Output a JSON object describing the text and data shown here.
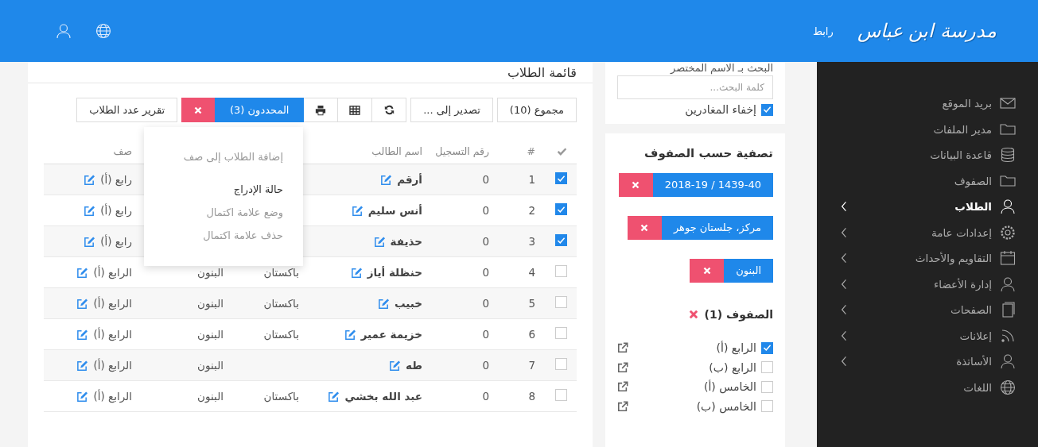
{
  "header": {
    "logo": "مدرسة ابن عباس",
    "link": "رابط"
  },
  "sidebar": {
    "items": [
      {
        "label": "بريد الموقع",
        "kind": "mail",
        "expandable": false,
        "selected": false
      },
      {
        "label": "مدير الملفات",
        "kind": "folder",
        "expandable": false,
        "selected": false
      },
      {
        "label": "قاعدة البيانات",
        "kind": "database",
        "expandable": false,
        "selected": false
      },
      {
        "label": "الصفوف",
        "kind": "folder",
        "expandable": false,
        "selected": false
      },
      {
        "label": "الطلاب",
        "kind": "user",
        "expandable": true,
        "selected": true
      },
      {
        "label": "إعدادات عامة",
        "kind": "gear",
        "expandable": true,
        "selected": false
      },
      {
        "label": "التقاويم والأحداث",
        "kind": "calendar",
        "expandable": true,
        "selected": false
      },
      {
        "label": "إدارة الأعضاء",
        "kind": "user",
        "expandable": true,
        "selected": false
      },
      {
        "label": "الصفحات",
        "kind": "pages",
        "expandable": true,
        "selected": false
      },
      {
        "label": "إعلانات",
        "kind": "rss",
        "expandable": true,
        "selected": false
      },
      {
        "label": "الأساتذة",
        "kind": "user",
        "expandable": true,
        "selected": false
      },
      {
        "label": "اللغات",
        "kind": "globe",
        "expandable": false,
        "selected": false
      }
    ]
  },
  "search": {
    "title": "البحث بـ الاسم المختصر",
    "placeholder": "كلمة البحث...",
    "hide_departed": {
      "label": "إخفاء المغادرين",
      "checked": true
    }
  },
  "filter": {
    "title": "تصفية حسب الصفوف",
    "chips": [
      "1439-40 / 2018-19",
      "مركز، جلستان جوهر",
      "البنون"
    ],
    "classes_title": "الصفوف (1)",
    "classes": [
      {
        "label": "الرابع (أ)",
        "checked": true
      },
      {
        "label": "الرابع (ب)",
        "checked": false
      },
      {
        "label": "الخامس (أ)",
        "checked": false
      },
      {
        "label": "الخامس (ب)",
        "checked": false
      }
    ]
  },
  "students": {
    "title": "قائمة الطلاب",
    "toolbar": [
      {
        "kind": "label",
        "label": "مجموع (10)"
      },
      {
        "kind": "label",
        "label": "تصدير إلى ..."
      },
      {
        "kind": "refresh"
      },
      {
        "kind": "table"
      },
      {
        "kind": "print"
      },
      {
        "kind": "selected",
        "label": "المحددون (3)"
      },
      {
        "kind": "label",
        "label": "تقرير عدد الطلاب"
      }
    ],
    "menu": [
      {
        "label": "إضافة الطلاب إلى صف",
        "disabled": true
      },
      {
        "label": "حالة الإدراج",
        "disabled": false
      },
      {
        "label": "وضع علامة اكتمال",
        "disabled": true
      },
      {
        "label": "حذف علامة اكتمال",
        "disabled": true
      }
    ],
    "header": {
      "number": "#",
      "registration": "رقم التسجيل",
      "name": "اسم الطالب",
      "class": "صف"
    },
    "rows": [
      {
        "selected": true,
        "number": "1",
        "registration": "0",
        "name": "أرقم",
        "class": "رابع (أ)"
      },
      {
        "selected": true,
        "number": "2",
        "registration": "0",
        "name": "أنس سليم",
        "class": "رابع (أ)"
      },
      {
        "selected": true,
        "number": "3",
        "registration": "0",
        "name": "حذيفة",
        "class": "رابع (أ)"
      },
      {
        "selected": false,
        "number": "4",
        "registration": "0",
        "name": "حنظلة أياز",
        "country": "باكستان",
        "section": "البنون",
        "class": "الرابع (أ)"
      },
      {
        "selected": false,
        "number": "5",
        "registration": "0",
        "name": "خبيب",
        "country": "باكستان",
        "section": "البنون",
        "class": "الرابع (أ)"
      },
      {
        "selected": false,
        "number": "6",
        "registration": "0",
        "name": "خزيمة عمير",
        "country": "باكستان",
        "section": "البنون",
        "class": "الرابع (أ)"
      },
      {
        "selected": false,
        "number": "7",
        "registration": "0",
        "name": "طه",
        "section": "البنون",
        "class": "الرابع (أ)"
      },
      {
        "selected": false,
        "number": "8",
        "registration": "0",
        "name": "عبد الله بخشي",
        "country": "باكستان",
        "section": "البنون",
        "class": "الرابع (أ)"
      }
    ]
  }
}
